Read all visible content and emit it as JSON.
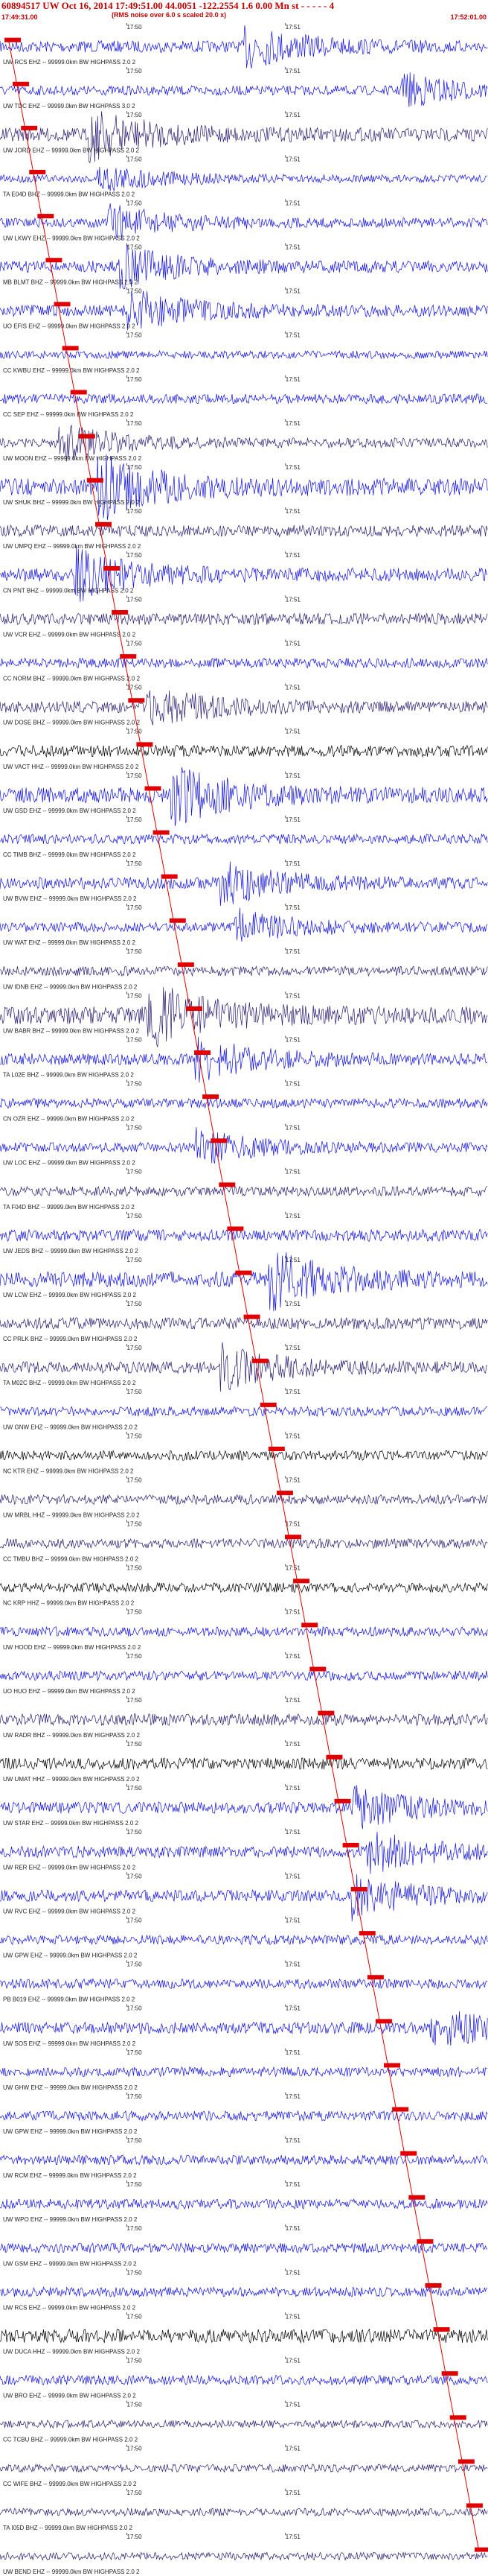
{
  "header": {
    "title": "60894517 UW Oct 16, 2014 17:49:51.00    44.0051 -122.2554  1.6 0.00 Mn st - - - - - 4",
    "subtitle": "(RMS noise over 6.0 s scaled 20.0 x)",
    "start_time": "17:49:31.00",
    "end_time": "17:52:01.00"
  },
  "tick_labels": [
    "17:50",
    "17:51"
  ],
  "colors": {
    "blue": "#1010e0",
    "purple": "#2a1a70",
    "black": "#000000",
    "red": "#e00000"
  },
  "stations": [
    {
      "label": "UW RCS EHZ -- 99999.0km BW  HIGHPASS  2.0  2",
      "color": "blue",
      "amp": 0.6,
      "quake": 0.5
    },
    {
      "label": "UW TDC EHZ -- 99999.0km BW  HIGHPASS  3.0  2",
      "color": "blue",
      "amp": 0.5,
      "quake": 0.82
    },
    {
      "label": "UW JORD EHZ -- 99999.0km BW  HIGHPASS  2.0  2",
      "color": "purple",
      "amp": 0.7,
      "quake": 0.18
    },
    {
      "label": "TA E04D BHZ -- 99999.0km BW  HIGHPASS  2.0  2",
      "color": "blue",
      "amp": 0.4,
      "quake": 0.2
    },
    {
      "label": "UW LKWY EHZ -- 99999.0km BW  HIGHPASS  2.0  2",
      "color": "blue",
      "amp": 0.5,
      "quake": 0.22
    },
    {
      "label": "MB BLMT BHZ -- 99999.0km BW  HIGHPASS  2.0  2",
      "color": "blue",
      "amp": 0.6,
      "quake": 0.24
    },
    {
      "label": "UO EFIS EHZ -- 99999.0km BW  HIGHPASS  2.0  2",
      "color": "blue",
      "amp": 0.6,
      "quake": 0.26
    },
    {
      "label": "CC KWBU EHZ -- 99999.0km BW  HIGHPASS  2.0  2",
      "color": "blue",
      "amp": 0.4,
      "quake": 0.0
    },
    {
      "label": "CC SEP EHZ -- 99999.0km BW  HIGHPASS  2.0  2",
      "color": "blue",
      "amp": 0.5,
      "quake": 0.0
    },
    {
      "label": "UW MOON EHZ -- 99999.0km BW  HIGHPASS  2.0  2",
      "color": "purple",
      "amp": 0.5,
      "quake": 0.12
    },
    {
      "label": "UW SHUK BHZ -- 99999.0km BW  HIGHPASS  2.0  2",
      "color": "blue",
      "amp": 0.9,
      "quake": 0.2
    },
    {
      "label": "UW UMPQ EHZ -- 99999.0km BW  HIGHPASS  2.0  2",
      "color": "purple",
      "amp": 0.6,
      "quake": 0.0
    },
    {
      "label": "CN PNT BHZ -- 99999.0km BW  HIGHPASS  2.0  2",
      "color": "blue",
      "amp": 0.7,
      "quake": 0.15
    },
    {
      "label": "UW VCR EHZ -- 99999.0km BW  HIGHPASS  2.0  2",
      "color": "purple",
      "amp": 0.6,
      "quake": 0.0
    },
    {
      "label": "CC NORM BHZ -- 99999.0km BW  HIGHPASS  2.0  2",
      "color": "blue",
      "amp": 0.5,
      "quake": 0.0
    },
    {
      "label": "UW DOSE BHZ -- 99999.0km BW  HIGHPASS  2.0  2",
      "color": "purple",
      "amp": 0.6,
      "quake": 0.3
    },
    {
      "label": "UW VACT HHZ -- 99999.0km BW  HIGHPASS  2.0  2",
      "color": "black",
      "amp": 0.6,
      "quake": 0.0
    },
    {
      "label": "UW GSD EHZ -- 99999.0km BW  HIGHPASS  2.0  2",
      "color": "blue",
      "amp": 0.8,
      "quake": 0.35
    },
    {
      "label": "CC TIMB BHZ -- 99999.0km BW  HIGHPASS  2.0  2",
      "color": "blue",
      "amp": 0.5,
      "quake": 0.0
    },
    {
      "label": "UW BVW EHZ -- 99999.0km BW  HIGHPASS  2.0  2",
      "color": "blue",
      "amp": 0.6,
      "quake": 0.45
    },
    {
      "label": "UW WAT EHZ -- 99999.0km BW  HIGHPASS  2.0  2",
      "color": "blue",
      "amp": 0.5,
      "quake": 0.48
    },
    {
      "label": "UW IDNB EHZ -- 99999.0km BW  HIGHPASS  2.0  2",
      "color": "purple",
      "amp": 0.5,
      "quake": 0.0
    },
    {
      "label": "UW BABR BHZ -- 99999.0km BW  HIGHPASS  2.0  2",
      "color": "purple",
      "amp": 0.9,
      "quake": 0.3
    },
    {
      "label": "TA L02E BHZ -- 99999.0km BW  HIGHPASS  2.0  2",
      "color": "blue",
      "amp": 0.6,
      "quake": 0.4
    },
    {
      "label": "CN OZR EHZ -- 99999.0km BW  HIGHPASS  2.0  2",
      "color": "blue",
      "amp": 0.5,
      "quake": 0.0
    },
    {
      "label": "UW LOC EHZ -- 99999.0km BW  HIGHPASS  2.0  2",
      "color": "blue",
      "amp": 0.5,
      "quake": 0.4
    },
    {
      "label": "TA F04D BHZ -- 99999.0km BW  HIGHPASS  2.0  2",
      "color": "purple",
      "amp": 0.5,
      "quake": 0.0
    },
    {
      "label": "UW JEDS BHZ -- 99999.0km BW  HIGHPASS  2.0  2",
      "color": "blue",
      "amp": 0.6,
      "quake": 0.0
    },
    {
      "label": "UW LCW EHZ -- 99999.0km BW  HIGHPASS  2.0  2",
      "color": "blue",
      "amp": 0.8,
      "quake": 0.55
    },
    {
      "label": "CC PRLK BHZ -- 99999.0km BW  HIGHPASS  2.0  2",
      "color": "purple",
      "amp": 0.6,
      "quake": 0.0
    },
    {
      "label": "TA M02C BHZ -- 99999.0km BW  HIGHPASS  2.0  2",
      "color": "purple",
      "amp": 0.6,
      "quake": 0.45
    },
    {
      "label": "UW GNW EHZ -- 99999.0km BW  HIGHPASS  2.0  2",
      "color": "blue",
      "amp": 0.5,
      "quake": 0.0
    },
    {
      "label": "NC KTR EHZ -- 99999.0km BW  HIGHPASS  2.0  2",
      "color": "black",
      "amp": 0.5,
      "quake": 0.0
    },
    {
      "label": "UW MRBL HHZ -- 99999.0km BW  HIGHPASS  2.0  2",
      "color": "purple",
      "amp": 0.5,
      "quake": 0.0
    },
    {
      "label": "CC TMBU BHZ -- 99999.0km BW  HIGHPASS  2.0  2",
      "color": "purple",
      "amp": 0.5,
      "quake": 0.0
    },
    {
      "label": "NC KRP HHZ -- 99999.0km BW  HIGHPASS  2.0  2",
      "color": "black",
      "amp": 0.5,
      "quake": 0.0
    },
    {
      "label": "UW HOOD EHZ -- 99999.0km BW  HIGHPASS  2.0  2",
      "color": "blue",
      "amp": 0.5,
      "quake": 0.0
    },
    {
      "label": "UO HUO EHZ -- 99999.0km BW  HIGHPASS  2.0  2",
      "color": "blue",
      "amp": 0.5,
      "quake": 0.0
    },
    {
      "label": "UW RADR BHZ -- 99999.0km BW  HIGHPASS  2.0  2",
      "color": "purple",
      "amp": 0.6,
      "quake": 0.0
    },
    {
      "label": "UW UMAT HHZ -- 99999.0km BW  HIGHPASS  2.0  2",
      "color": "black",
      "amp": 0.6,
      "quake": 0.0
    },
    {
      "label": "UW STAR EHZ -- 99999.0km BW  HIGHPASS  2.0  2",
      "color": "blue",
      "amp": 0.6,
      "quake": 0.72
    },
    {
      "label": "UW RER EHZ -- 99999.0km BW  HIGHPASS  2.0  2",
      "color": "blue",
      "amp": 0.6,
      "quake": 0.75
    },
    {
      "label": "UW RVC EHZ -- 99999.0km BW  HIGHPASS  2.0  2",
      "color": "blue",
      "amp": 0.6,
      "quake": 0.72
    },
    {
      "label": "UW GPW EHZ -- 99999.0km BW  HIGHPASS  2.0  2",
      "color": "blue",
      "amp": 0.5,
      "quake": 0.0
    },
    {
      "label": "PB B019 EHZ -- 99999.0km BW  HIGHPASS  2.0  2",
      "color": "blue",
      "amp": 0.5,
      "quake": 0.0
    },
    {
      "label": "UW SOS EHZ -- 99999.0km BW  HIGHPASS  2.0  2",
      "color": "blue",
      "amp": 0.6,
      "quake": 0.88
    },
    {
      "label": "UW GHW EHZ -- 99999.0km BW  HIGHPASS  2.0  2",
      "color": "blue",
      "amp": 0.5,
      "quake": 0.0
    },
    {
      "label": "UW GPW EHZ -- 99999.0km BW  HIGHPASS  2.0  2",
      "color": "blue",
      "amp": 0.5,
      "quake": 0.0
    },
    {
      "label": "UW RCM EHZ -- 99999.0km BW  HIGHPASS  2.0  2",
      "color": "blue",
      "amp": 0.5,
      "quake": 0.0
    },
    {
      "label": "UW WPO EHZ -- 99999.0km BW  HIGHPASS  2.0  2",
      "color": "blue",
      "amp": 0.5,
      "quake": 0.0
    },
    {
      "label": "UW GSM EHZ -- 99999.0km BW  HIGHPASS  2.0  2",
      "color": "blue",
      "amp": 0.5,
      "quake": 0.0
    },
    {
      "label": "UW RCS EHZ -- 99999.0km BW  HIGHPASS  2.0  2",
      "color": "blue",
      "amp": 0.5,
      "quake": 0.0
    },
    {
      "label": "UW DUCA HHZ -- 99999.0km BW  HIGHPASS  2.0  2",
      "color": "black",
      "amp": 0.7,
      "quake": 0.0
    },
    {
      "label": "UW BRO EHZ -- 99999.0km BW  HIGHPASS  2.0  2",
      "color": "blue",
      "amp": 0.5,
      "quake": 0.0
    },
    {
      "label": "CC TCBU BHZ -- 99999.0km BW  HIGHPASS  2.0  2",
      "color": "purple",
      "amp": 0.4,
      "quake": 0.0
    },
    {
      "label": "CC WIFE BHZ -- 99999.0km BW  HIGHPASS  2.0  2",
      "color": "purple",
      "amp": 0.4,
      "quake": 0.0
    },
    {
      "label": "TA I05D BHZ -- 99999.0km BW  HIGHPASS  2.0  2",
      "color": "purple",
      "amp": 0.4,
      "quake": 0.0
    },
    {
      "label": "UW BEND EHZ -- 99999.0km BW  HIGHPASS  2.0  2",
      "color": "purple",
      "amp": 0.4,
      "quake": 0.0
    }
  ]
}
